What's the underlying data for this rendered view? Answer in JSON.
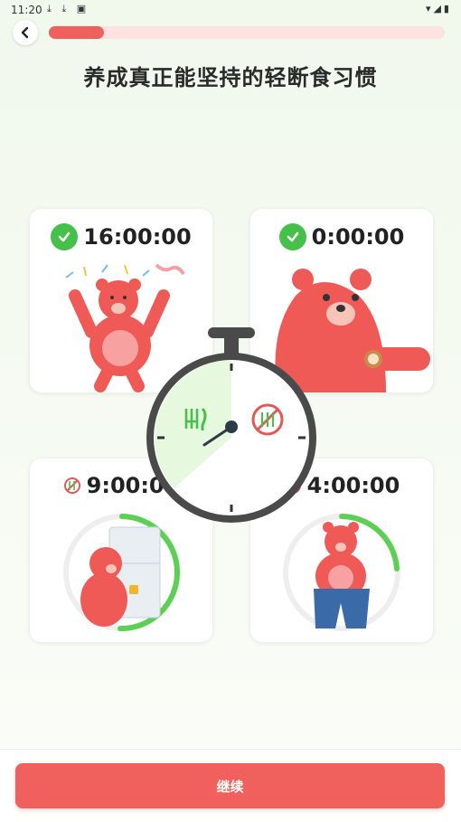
{
  "status_bar": {
    "time": "11:20"
  },
  "progress": {
    "fraction": 0.14
  },
  "title": "养成真正能坚持的轻断食习惯",
  "cards": [
    {
      "time": "16:00:00",
      "icon": "check-icon"
    },
    {
      "time": "0:00:00",
      "icon": "check-icon"
    },
    {
      "time": "9:00:00",
      "icon": "no-food-icon"
    },
    {
      "time": "4:00:00",
      "icon": "no-food-icon"
    }
  ],
  "timer": {
    "eating_icon": "fork-knife-icon",
    "fasting_icon": "no-fork-knife-icon"
  },
  "colors": {
    "accent": "#f0605c",
    "green": "#45c04a",
    "bear": "#ef5a57"
  },
  "continue_label": "继续"
}
